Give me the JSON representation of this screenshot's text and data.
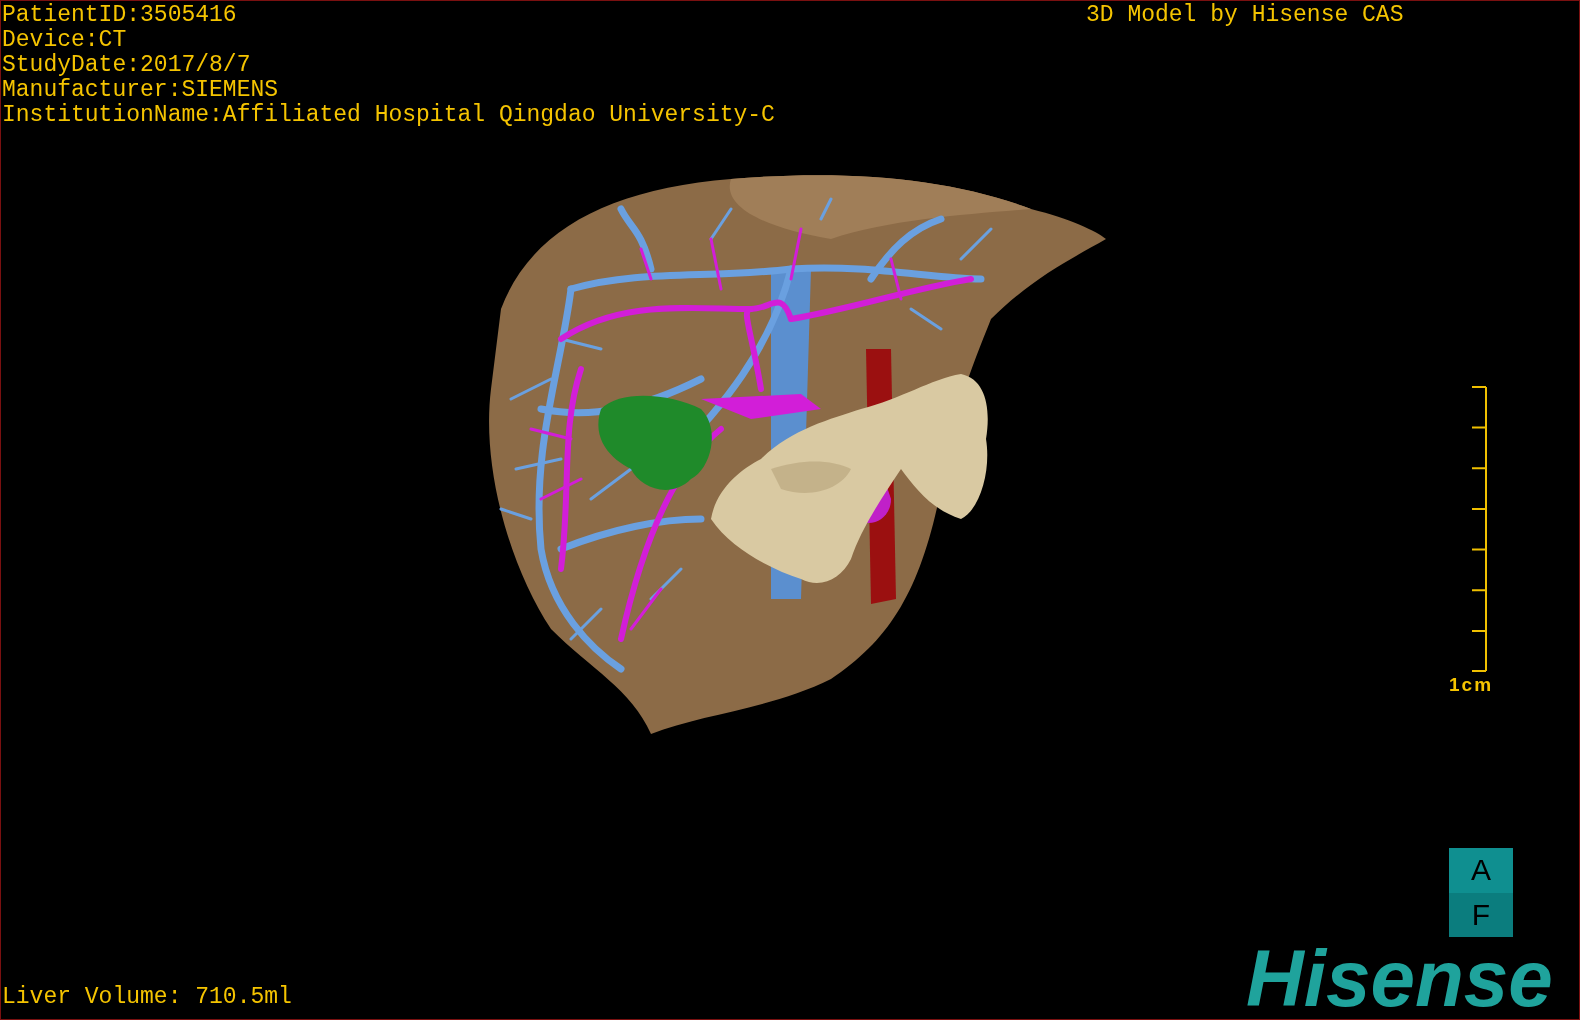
{
  "patient_info": [
    "PatientID:3505416",
    "Device:CT",
    "StudyDate:2017/8/7",
    "Manufacturer:SIEMENS",
    "InstitutionName:Affiliated Hospital Qingdao University-C"
  ],
  "header": "3D Model by Hisense CAS",
  "scale_bar": {
    "label": "1cm"
  },
  "orientation": {
    "top": "A",
    "bottom": "F"
  },
  "logo": "Hisense",
  "liver_volume": "Liver Volume: 710.5ml"
}
